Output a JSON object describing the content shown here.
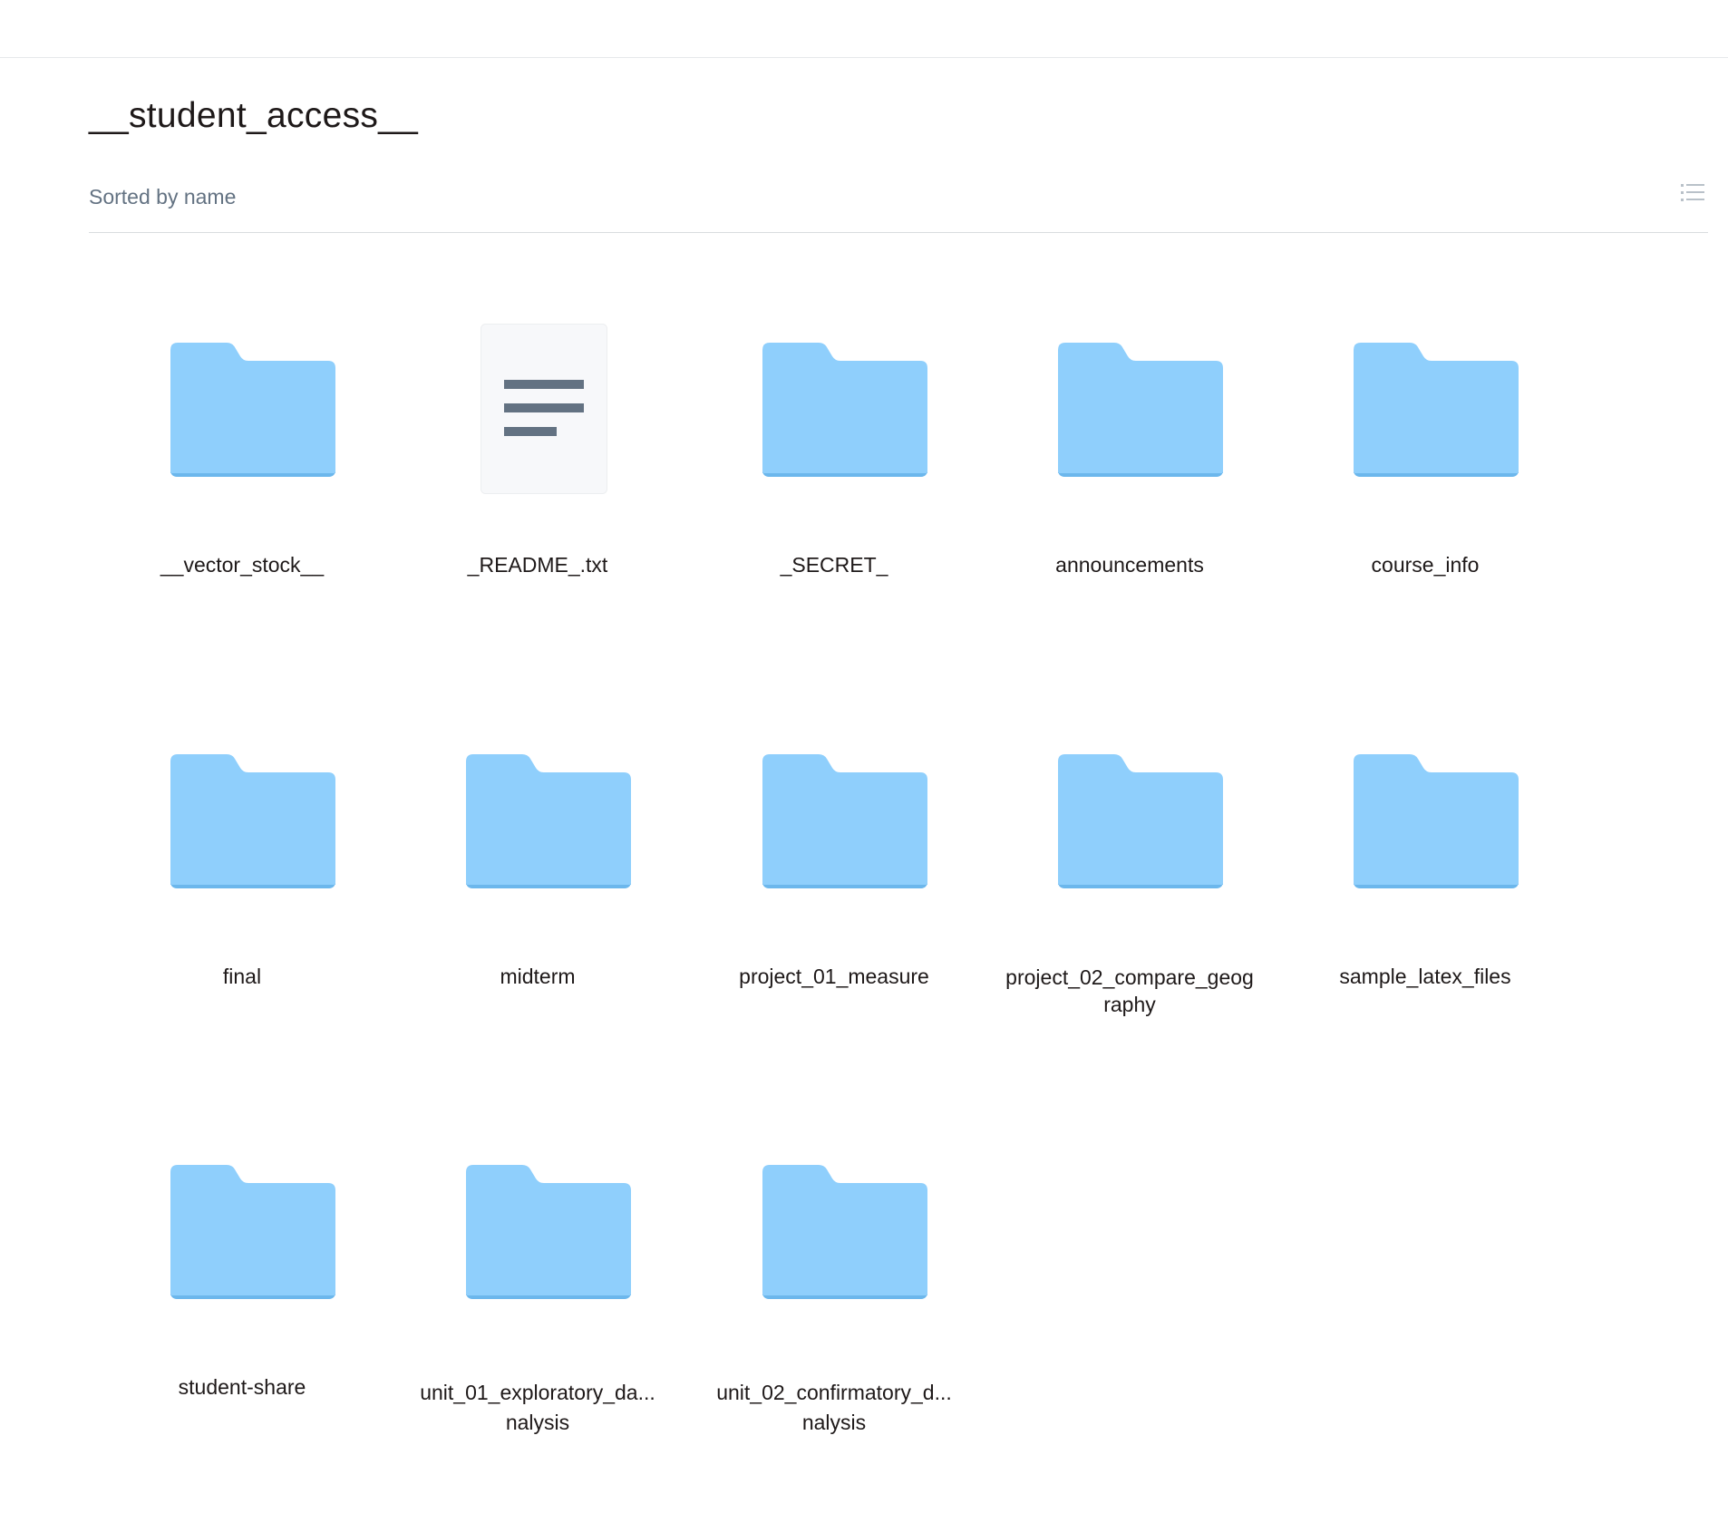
{
  "folder": {
    "title": "__student_access__",
    "sort_label": "Sorted by name",
    "view_icon": "list-view-icon"
  },
  "colors": {
    "folder": "#8fcffc",
    "folder_shadow": "#6cb7ec",
    "doc_bg": "#f7f8fa",
    "doc_lines": "#637282"
  },
  "items": [
    {
      "name": "__vector_stock__",
      "type": "folder"
    },
    {
      "name": "_README_.txt",
      "type": "text-file"
    },
    {
      "name": "_SECRET_",
      "type": "folder"
    },
    {
      "name": "announcements",
      "type": "folder"
    },
    {
      "name": "course_info",
      "type": "folder"
    },
    {
      "name": "final",
      "type": "folder"
    },
    {
      "name": "midterm",
      "type": "folder"
    },
    {
      "name": "project_01_measure",
      "type": "folder"
    },
    {
      "name": "project_02_compare_geography",
      "type": "folder"
    },
    {
      "name": "sample_latex_files",
      "type": "folder"
    },
    {
      "name": "student-share",
      "type": "folder"
    },
    {
      "name": "unit_01_exploratory_da... nalysis",
      "type": "folder"
    },
    {
      "name": "unit_02_confirmatory_d... nalysis",
      "type": "folder"
    }
  ]
}
